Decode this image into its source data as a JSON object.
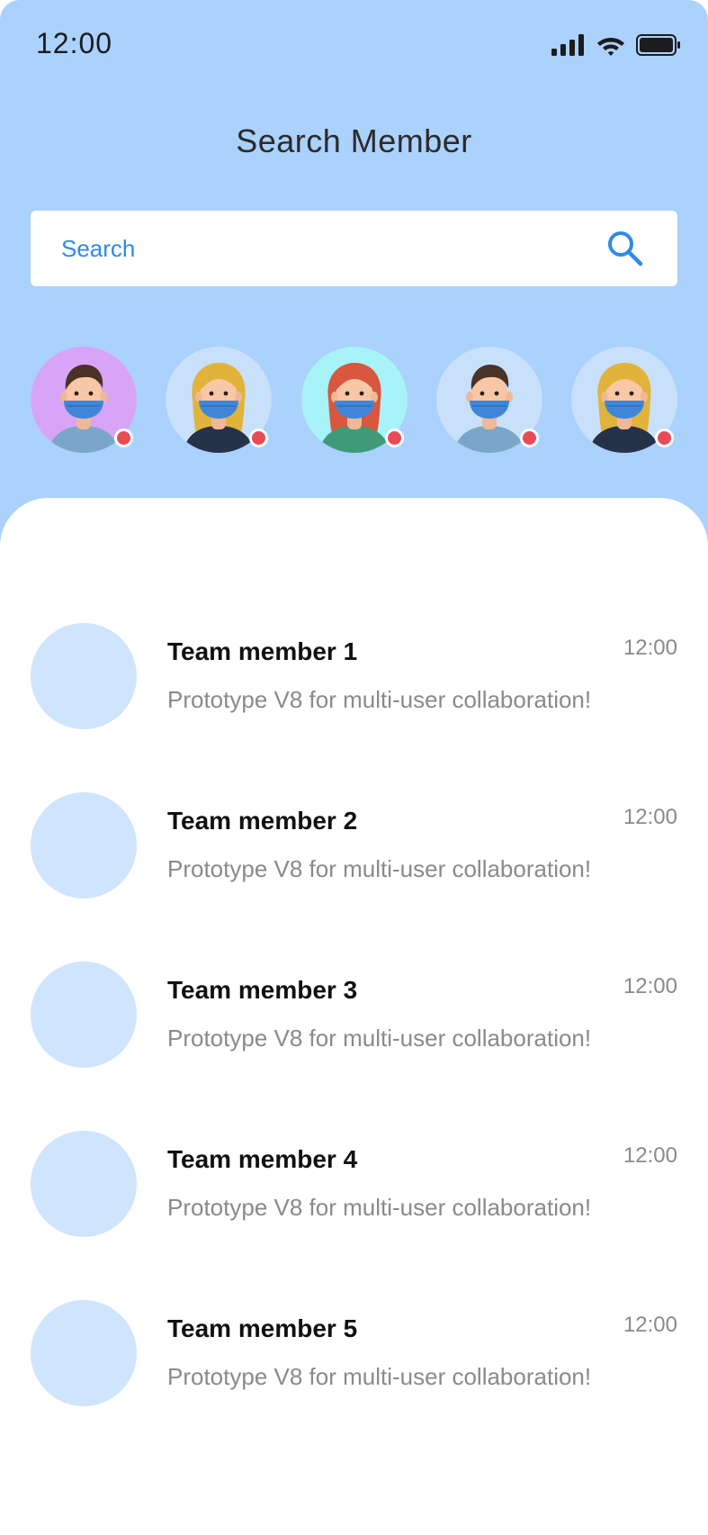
{
  "status_bar": {
    "time": "12:00",
    "icons": [
      "cellular-signal-icon",
      "wifi-icon",
      "battery-icon"
    ]
  },
  "header": {
    "title": "Search Member"
  },
  "search": {
    "placeholder": "Search",
    "icon": "search-icon"
  },
  "stories": [
    {
      "bg": "#d8a4f7",
      "hair": "#4a3227",
      "hair_style": "short",
      "shirt": "#7aa7c7",
      "online": true
    },
    {
      "bg": "#c9e0fb",
      "hair": "#e1b33b",
      "hair_style": "long",
      "shirt": "#26324a",
      "online": true
    },
    {
      "bg": "#a8f3f7",
      "hair": "#d9563f",
      "hair_style": "long",
      "shirt": "#3f9a7a",
      "online": true
    },
    {
      "bg": "#c9e0fb",
      "hair": "#4a3227",
      "hair_style": "short",
      "shirt": "#7aa7c7",
      "online": true
    },
    {
      "bg": "#c9e0fb",
      "hair": "#e1b33b",
      "hair_style": "long",
      "shirt": "#26324a",
      "online": true
    }
  ],
  "members": [
    {
      "name": "Team member 1",
      "time": "12:00",
      "message": "Prototype V8 for multi-user collaboration!"
    },
    {
      "name": "Team member 2",
      "time": "12:00",
      "message": "Prototype V8 for multi-user collaboration!"
    },
    {
      "name": "Team member 3",
      "time": "12:00",
      "message": "Prototype V8 for multi-user collaboration!"
    },
    {
      "name": "Team member 4",
      "time": "12:00",
      "message": "Prototype V8 for multi-user collaboration!"
    },
    {
      "name": "Team member 5",
      "time": "12:00",
      "message": "Prototype V8 for multi-user collaboration!"
    }
  ],
  "colors": {
    "header_bg": "#abd1fd",
    "accent": "#2f8ae8",
    "online_dot": "#e94b56",
    "avatar_placeholder": "#cfe5fd"
  }
}
